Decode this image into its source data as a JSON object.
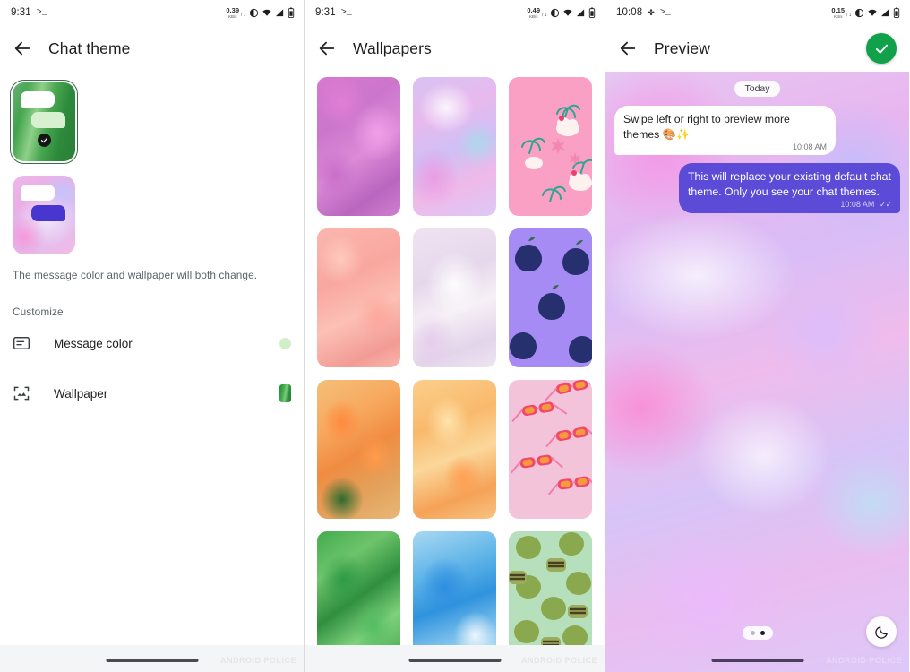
{
  "panel1": {
    "status": {
      "time": "9:31",
      "terminal_glyph": ">_",
      "net_speed": "0.39",
      "net_unit": "KB/s",
      "icons": [
        "net-arrows-icon",
        "brightness-icon",
        "wifi-icon",
        "signal-icon",
        "battery-icon"
      ]
    },
    "appbar": {
      "back_icon": "back-arrow-icon",
      "title": "Chat theme"
    },
    "themes": [
      {
        "name": "green-theme",
        "selected": true,
        "check_icon": "check-icon"
      },
      {
        "name": "pink-theme",
        "selected": false
      }
    ],
    "hint": "The message color and wallpaper will both change.",
    "section_label": "Customize",
    "rows": [
      {
        "icon": "message-color-icon",
        "label": "Message color",
        "swatch": "dot",
        "swatch_color": "#d2f0c8"
      },
      {
        "icon": "wallpaper-image-icon",
        "label": "Wallpaper",
        "swatch": "rect",
        "swatch_color": "#2f9440"
      }
    ],
    "watermark": "ANDROID POLICE"
  },
  "panel2": {
    "status": {
      "time": "9:31",
      "terminal_glyph": ">_",
      "net_speed": "0.49",
      "net_unit": "KB/s"
    },
    "appbar": {
      "back_icon": "back-arrow-icon",
      "title": "Wallpapers"
    },
    "wallpapers": [
      {
        "id": "w1",
        "name": "purple-peony-flower"
      },
      {
        "id": "w2",
        "name": "pastel-holographic"
      },
      {
        "id": "w3",
        "name": "pink-palm-cupcake-pattern"
      },
      {
        "id": "w4",
        "name": "coral-floral-blur"
      },
      {
        "id": "w5",
        "name": "white-lilac-petals"
      },
      {
        "id": "w6",
        "name": "purple-figs-pattern"
      },
      {
        "id": "w7",
        "name": "orange-canna-lily"
      },
      {
        "id": "w8",
        "name": "orange-abstract-swirl"
      },
      {
        "id": "w9",
        "name": "pink-sunglasses-pattern"
      },
      {
        "id": "w10",
        "name": "green-aloe-leaves"
      },
      {
        "id": "w11",
        "name": "blue-abstract-gradient"
      },
      {
        "id": "w12",
        "name": "green-olives-pattern"
      }
    ],
    "watermark": "ANDROID POLICE"
  },
  "panel3": {
    "status": {
      "time": "10:08",
      "terminal_glyph": ">_",
      "net_speed": "0.15",
      "net_unit": "KB/s"
    },
    "appbar": {
      "back_icon": "back-arrow-icon",
      "title": "Preview",
      "confirm_icon": "check-icon"
    },
    "chat": {
      "day_chip": "Today",
      "messages": [
        {
          "side": "received",
          "text": "Swipe left or right to preview more themes 🎨✨",
          "time": "10:08 AM",
          "ticks": ""
        },
        {
          "side": "sent",
          "text": "This will replace your existing default chat theme. Only you see your chat themes.",
          "time": "10:08 AM",
          "ticks": "✓✓"
        }
      ]
    },
    "pager": {
      "dots": 2,
      "active_index": 1
    },
    "dark_mode_button": {
      "icon": "moon-icon"
    },
    "watermark": "ANDROID POLICE"
  },
  "colors": {
    "accent_green": "#11a14a",
    "sent_bubble": "#5b4bd6",
    "recv_bubble": "#ffffff"
  }
}
